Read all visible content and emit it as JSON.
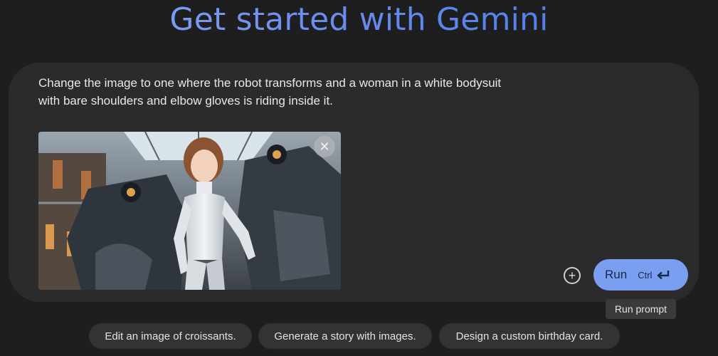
{
  "header": {
    "title": "Get started with Gemini"
  },
  "prompt": {
    "text": "Change the image to one where the robot transforms and a woman in a white bodysuit\nwith bare shoulders and elbow gloves is riding inside it.",
    "attachment": {
      "remove_icon": "close-icon"
    }
  },
  "actions": {
    "add_icon": "add-circle-icon",
    "run_label": "Run",
    "run_shortcut": "Ctrl",
    "run_shortcut_icon": "enter-key-icon",
    "run_tooltip": "Run prompt"
  },
  "suggestions": [
    "Edit an image of croissants.",
    "Generate a story with images.",
    "Design a custom birthday card."
  ],
  "colors": {
    "background": "#1e1e1e",
    "card": "#2b2b2b",
    "run_button": "#7b9ff0",
    "chip": "#333333"
  }
}
